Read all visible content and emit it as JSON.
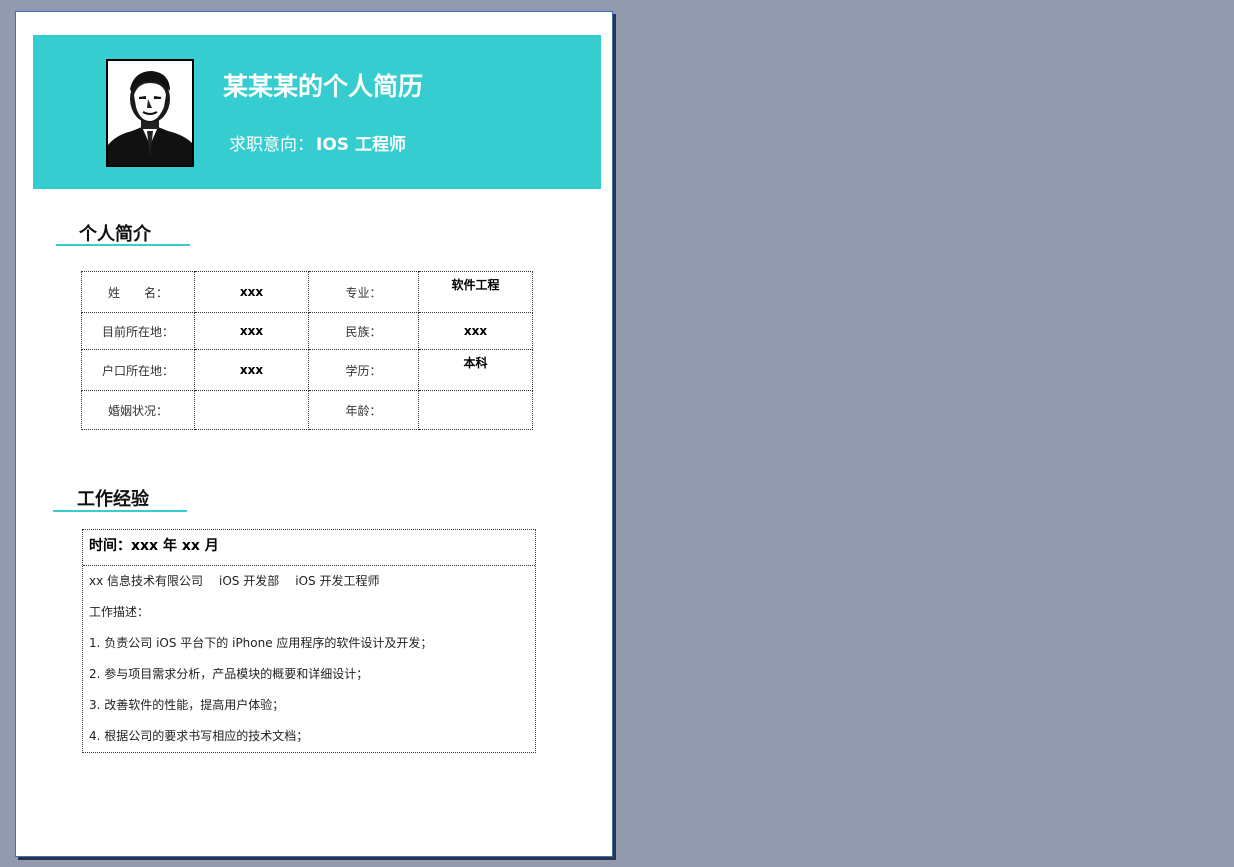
{
  "header": {
    "title": "某某某的个人简历",
    "objective_label": "求职意向：",
    "objective_value": "IOS 工程师"
  },
  "sections": {
    "profile_heading": "个人简介",
    "experience_heading": "工作经验"
  },
  "profile_table": [
    [
      {
        "text": "姓　　名：",
        "kind": "label"
      },
      {
        "text": "xxx",
        "kind": "value"
      },
      {
        "text": "专业：",
        "kind": "label"
      },
      {
        "text": "软件工程",
        "kind": "value"
      }
    ],
    [
      {
        "text": "目前所在地：",
        "kind": "label"
      },
      {
        "text": "xxx",
        "kind": "value"
      },
      {
        "text": "民族：",
        "kind": "label"
      },
      {
        "text": "xxx",
        "kind": "value"
      }
    ],
    [
      {
        "text": "户口所在地：",
        "kind": "label"
      },
      {
        "text": "xxx",
        "kind": "value"
      },
      {
        "text": "学历：",
        "kind": "label"
      },
      {
        "text": "本科",
        "kind": "value"
      }
    ],
    [
      {
        "text": "婚姻状况：",
        "kind": "label"
      },
      {
        "text": "",
        "kind": "value"
      },
      {
        "text": "年龄：",
        "kind": "label"
      },
      {
        "text": "",
        "kind": "value"
      }
    ]
  ],
  "experience": {
    "time": "时间：xxx 年 xx 月",
    "company": "xx 信息技术有限公司",
    "department": "iOS 开发部",
    "position": "iOS 开发工程师",
    "desc_label": "工作描述：",
    "duties": [
      "1. 负责公司 iOS 平台下的 iPhone 应用程序的软件设计及开发；",
      "2. 参与项目需求分析，产品模块的概要和详细设计；",
      "3. 改善软件的性能，提高用户体验；",
      "4.  根据公司的要求书写相应的技术文档；"
    ]
  },
  "colors": {
    "accent": "#35cdd0",
    "background": "#939aae"
  }
}
